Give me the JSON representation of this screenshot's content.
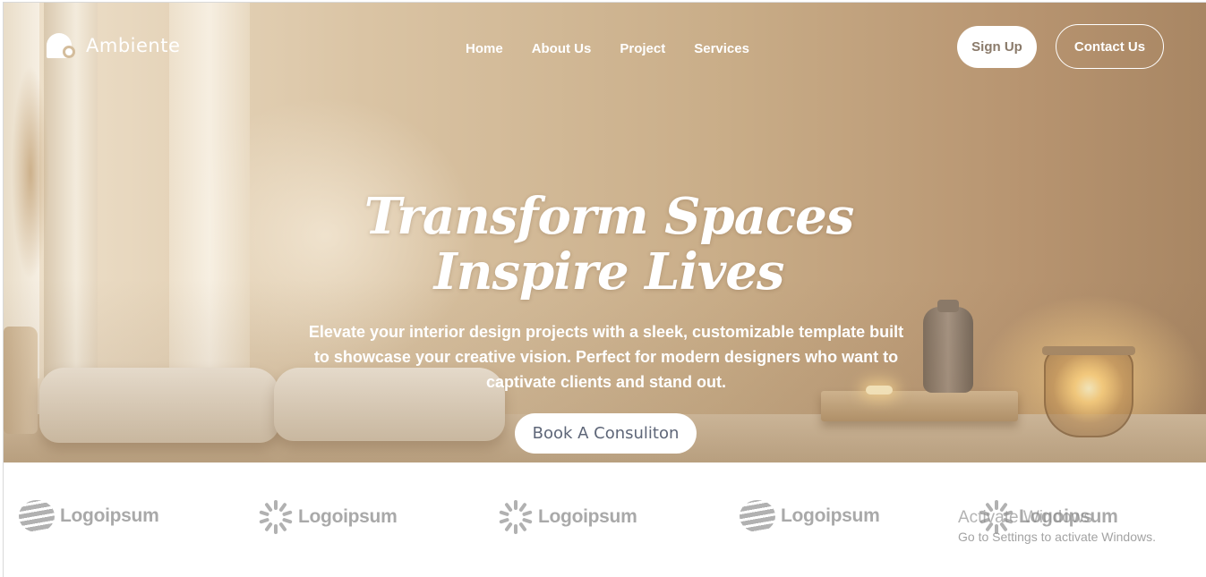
{
  "brand": {
    "name": "Ambiente",
    "logo_icon": "house-circle-icon"
  },
  "nav": {
    "items": [
      "Home",
      "About Us",
      "Project",
      "Services"
    ]
  },
  "header": {
    "signup_label": "Sign Up",
    "contact_label": "Contact Us"
  },
  "hero": {
    "headline_line1": "Transform Spaces",
    "headline_line2": "Inspire Lives",
    "subtext": "Elevate your interior design projects with a sleek, customizable template built to showcase your creative vision. Perfect for modern designers who want to captivate clients and stand out.",
    "cta_label": "Book A Consuliton"
  },
  "partner_logos": [
    {
      "name": "Logoipsum",
      "icon": "wave-icon"
    },
    {
      "name": "Logoipsum",
      "icon": "sunburst-icon"
    },
    {
      "name": "Logoipsum",
      "icon": "sunburst-icon"
    },
    {
      "name": "Logoipsum",
      "icon": "wave-icon"
    },
    {
      "name": "Logoipsum",
      "icon": "sunburst-icon"
    }
  ],
  "windows_watermark": {
    "title": "Activate Windows",
    "subtitle": "Go to Settings to activate Windows."
  },
  "colors": {
    "hero_tone": "#c9ad88",
    "logo_gray": "#a9a9a9",
    "cta_text": "#5e6678"
  }
}
